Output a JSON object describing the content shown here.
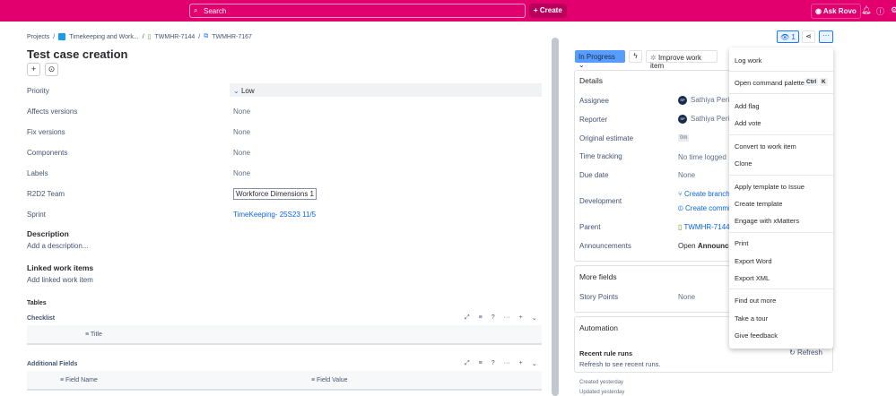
{
  "topbar": {
    "search_placeholder": "Search",
    "create": "+ Create",
    "ask_rovo": "Ask Rovo"
  },
  "breadcrumb": [
    "Projects",
    "Timekeeping and Work...",
    "TWMHR-7144",
    "TWMHR-7167"
  ],
  "title": "Test case creation",
  "fields": [
    {
      "label": "Priority",
      "value": "Low"
    },
    {
      "label": "Affects versions",
      "value": "None"
    },
    {
      "label": "Fix versions",
      "value": "None"
    },
    {
      "label": "Components",
      "value": "None"
    },
    {
      "label": "Labels",
      "value": "None"
    },
    {
      "label": "R2D2 Team",
      "value": "Workforce Dimensions 1"
    },
    {
      "label": "Sprint",
      "value": "TimeKeeping- 25S23 11/5"
    }
  ],
  "description": {
    "heading": "Description",
    "placeholder": "Add a description..."
  },
  "linked": {
    "heading": "Linked work items",
    "placeholder": "Add linked work item"
  },
  "tables": {
    "heading": "Tables",
    "checklist": {
      "name": "Checklist",
      "columns": [
        "Title"
      ]
    },
    "additional": {
      "name": "Additional Fields",
      "columns": [
        "Field Name",
        "Field Value"
      ]
    }
  },
  "header_actions": {
    "watch_count": "1"
  },
  "status": {
    "label": "In Progress",
    "improve": "Improve work item"
  },
  "details": {
    "heading": "Details",
    "rows": [
      {
        "label": "Assignee",
        "value": "Sathiya Periy",
        "initials": "SP"
      },
      {
        "label": "Reporter",
        "value": "Sathiya Periy",
        "initials": "SP"
      },
      {
        "label": "Original estimate",
        "value": "0m"
      },
      {
        "label": "Time tracking",
        "value": "No time logged"
      },
      {
        "label": "Due date",
        "value": "None"
      },
      {
        "label": "Development",
        "value": "Create branch",
        "value2": "Create commit"
      },
      {
        "label": "Parent",
        "value": "TWMHR-7144"
      },
      {
        "label": "Announcements",
        "value": "Open",
        "value_bold": "Announcen"
      }
    ]
  },
  "more_fields": {
    "heading": "More fields",
    "label": "Story Points",
    "value": "None"
  },
  "automation": {
    "heading": "Automation",
    "recent": "Recent rule runs",
    "refresh": "Refresh",
    "hint": "Refresh to see recent runs."
  },
  "meta": {
    "created": "Created yesterday",
    "updated": "Updated yesterday"
  },
  "menu": {
    "items": [
      "Log work",
      "Open command palette",
      "Add flag",
      "Add vote",
      "Convert to work item",
      "Clone",
      "Apply template to Issue",
      "Create template",
      "Engage with xMatters",
      "Print",
      "Export Word",
      "Export XML",
      "Find out more",
      "Take a tour",
      "Give feedback"
    ],
    "shortcut": [
      "Ctrl",
      "K"
    ]
  }
}
